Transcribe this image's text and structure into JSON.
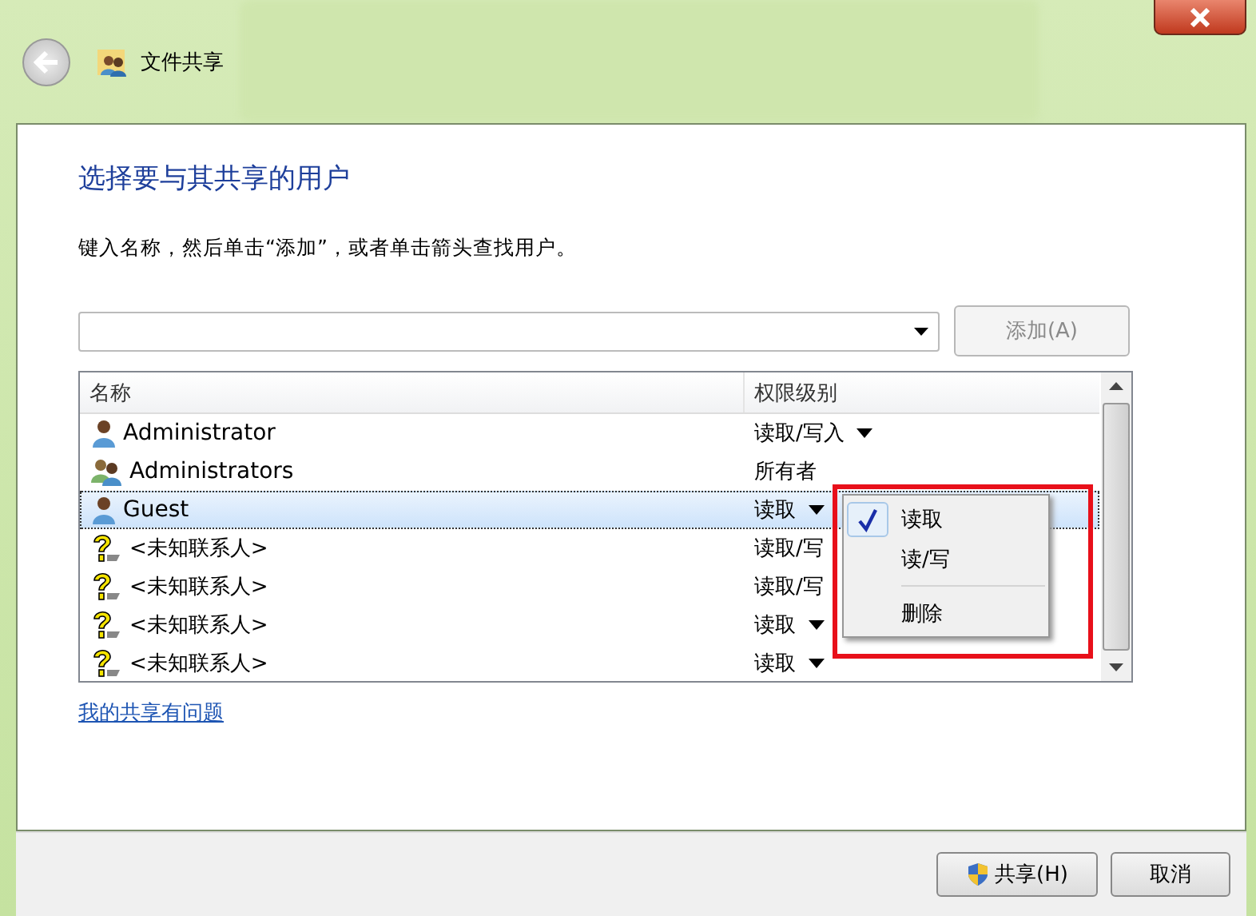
{
  "window": {
    "title": "文件共享"
  },
  "heading": "选择要与其共享的用户",
  "instruction": "键入名称，然后单击“添加”，或者单击箭头查找用户。",
  "add_button": {
    "label": "添加(A)",
    "disabled": true
  },
  "table": {
    "columns": [
      "名称",
      "权限级别"
    ],
    "rows": [
      {
        "kind": "user",
        "name": "Administrator",
        "permission": "读取/写入",
        "dropdown": true,
        "selected": false
      },
      {
        "kind": "group",
        "name": "Administrators",
        "permission": "所有者",
        "dropdown": false,
        "selected": false
      },
      {
        "kind": "user",
        "name": "Guest",
        "permission": "读取",
        "dropdown": true,
        "selected": true
      },
      {
        "kind": "unknown",
        "name": "<未知联系人>",
        "permission": "读取/写",
        "dropdown": false,
        "selected": false
      },
      {
        "kind": "unknown",
        "name": "<未知联系人>",
        "permission": "读取/写",
        "dropdown": false,
        "selected": false
      },
      {
        "kind": "unknown",
        "name": "<未知联系人>",
        "permission": "读取",
        "dropdown": true,
        "selected": false
      },
      {
        "kind": "unknown",
        "name": "<未知联系人>",
        "permission": "读取",
        "dropdown": true,
        "selected": false
      }
    ]
  },
  "menu": {
    "items": [
      {
        "label": "读取",
        "checked": true,
        "separator_before": false
      },
      {
        "label": "读/写",
        "checked": false,
        "separator_before": false
      },
      {
        "label": "删除",
        "checked": false,
        "separator_before": true
      }
    ]
  },
  "help_link": "我的共享有问题",
  "buttons": [
    {
      "label": "共享(H)",
      "shield": true
    },
    {
      "label": "取消",
      "shield": false
    }
  ]
}
